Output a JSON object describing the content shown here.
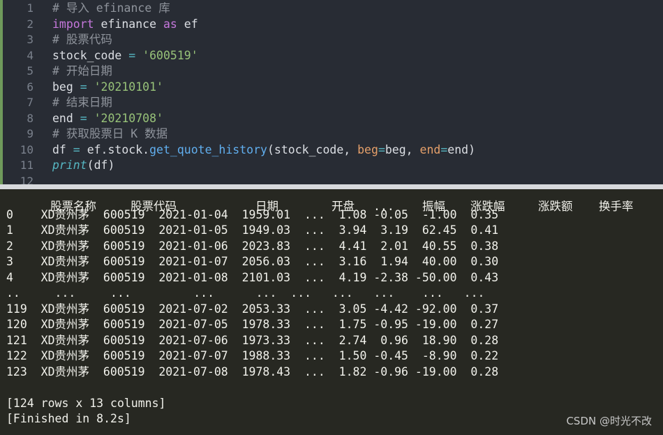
{
  "editor": {
    "line_numbers": [
      "1",
      "2",
      "3",
      "4",
      "5",
      "6",
      "7",
      "8",
      "9",
      "10",
      "11",
      "12"
    ],
    "comments": {
      "c1": "# 导入 efinance 库",
      "c3": "# 股票代码",
      "c5": "# 开始日期",
      "c7": "# 结束日期",
      "c9": "# 获取股票日 K 数据"
    },
    "tokens": {
      "import_kw": "import",
      "module": " efinance ",
      "as_kw": "as",
      "alias": " ef",
      "stock_var": "stock_code",
      "eq": " = ",
      "stock_val": "'600519'",
      "beg_var": "beg",
      "beg_val": "'20210101'",
      "end_var": "end",
      "end_val": "'20210708'",
      "df_var": "df",
      "ef_stock": "ef.stock.",
      "func": "get_quote_history",
      "call_open": "(stock_code, ",
      "beg_param": "beg",
      "eq_op": "=",
      "beg_arg": "beg, ",
      "end_param": "end",
      "end_arg": "end)",
      "print_fn": "print",
      "print_args": "(df)"
    }
  },
  "console": {
    "headers": [
      "股票名称",
      "股票代码",
      "日期",
      "开盘",
      "...",
      "振幅",
      "涨跌幅",
      "涨跌额",
      "换手率"
    ],
    "rows": [
      "0    XD贵州茅  600519  2021-01-04  1959.01  ...  1.08 -0.05  -1.00  0.35",
      "1    XD贵州茅  600519  2021-01-05  1949.03  ...  3.94  3.19  62.45  0.41",
      "2    XD贵州茅  600519  2021-01-06  2023.83  ...  4.41  2.01  40.55  0.38",
      "3    XD贵州茅  600519  2021-01-07  2056.03  ...  3.16  1.94  40.00  0.30",
      "4    XD贵州茅  600519  2021-01-08  2101.03  ...  4.19 -2.38 -50.00  0.43",
      "..     ...     ...         ...      ...  ...   ...   ...    ...   ...",
      "119  XD贵州茅  600519  2021-07-02  2053.33  ...  3.05 -4.42 -92.00  0.37",
      "120  XD贵州茅  600519  2021-07-05  1978.33  ...  1.75 -0.95 -19.00  0.27",
      "121  XD贵州茅  600519  2021-07-06  1973.33  ...  2.74  0.96  18.90  0.28",
      "122  XD贵州茅  600519  2021-07-07  1988.33  ...  1.50 -0.45  -8.90  0.22",
      "123  XD贵州茅  600519  2021-07-08  1978.43  ...  1.82 -0.96 -19.00  0.28"
    ],
    "summary": "[124 rows x 13 columns]",
    "finished": "[Finished in 8.2s]"
  },
  "watermark": "CSDN @时光不改"
}
